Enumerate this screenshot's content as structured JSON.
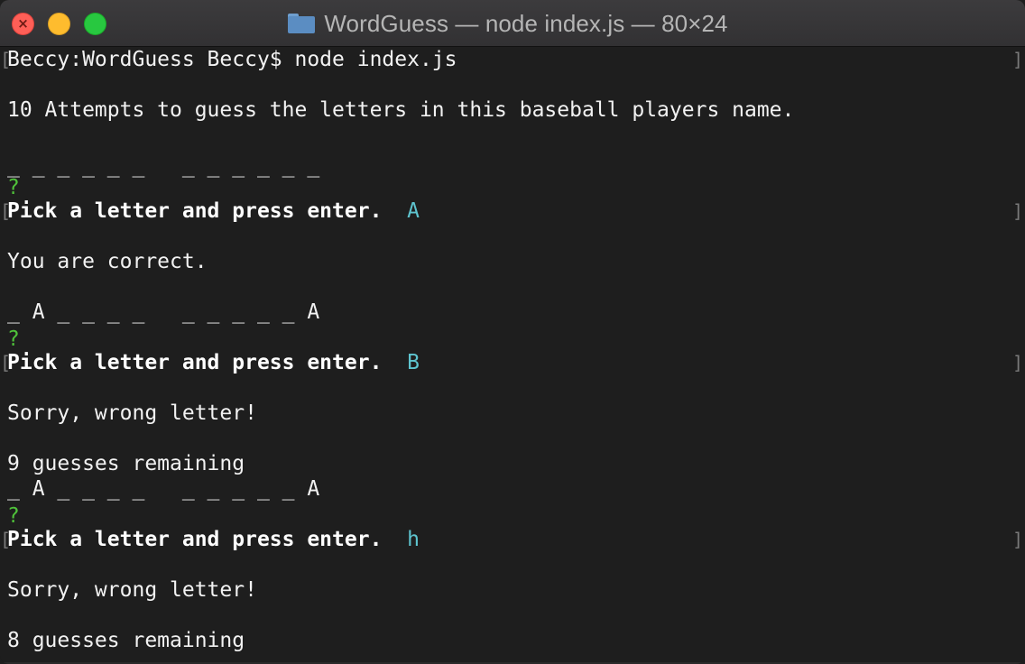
{
  "window": {
    "title": "WordGuess — node index.js — 80×24",
    "close_glyph": "×"
  },
  "terminal": {
    "command_line": "Beccy:WordGuess Beccy$ node index.js",
    "intro": "10 Attempts to guess the letters in this baseball players name.",
    "board_initial": "_ _ _ _ _ _   _ _ _ _ _ _",
    "rounds": [
      {
        "prompt_mark": "?",
        "prompt": "Pick a letter and press enter.",
        "answer": "A",
        "result": "You are correct.",
        "remaining": "",
        "board": "_ A _ _ _ _   _ _ _ _ _ A"
      },
      {
        "prompt_mark": "?",
        "prompt": "Pick a letter and press enter.",
        "answer": "B",
        "result": "Sorry, wrong letter!",
        "remaining": "9 guesses remaining",
        "board": "_ A _ _ _ _   _ _ _ _ _ A"
      },
      {
        "prompt_mark": "?",
        "prompt": "Pick a letter and press enter.",
        "answer": "h",
        "result": "Sorry, wrong letter!",
        "remaining": "8 guesses remaining",
        "board": ""
      }
    ],
    "brackets": {
      "left": "[",
      "right": "]"
    }
  }
}
